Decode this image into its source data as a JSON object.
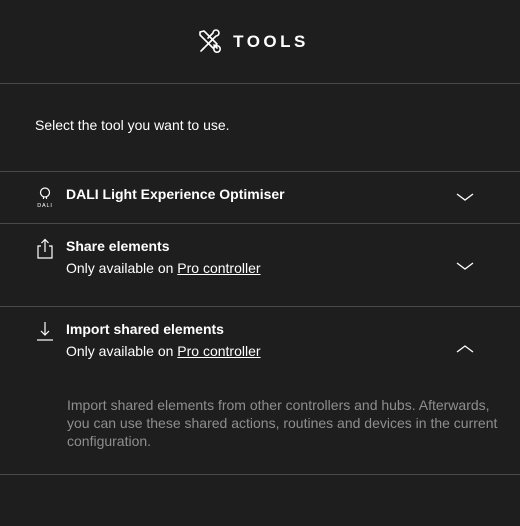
{
  "header": {
    "title": "TOOLS",
    "icon": "tools-icon"
  },
  "intro": "Select the tool you want to use.",
  "tools": [
    {
      "name": "DALI Light Experience Optimiser",
      "icon": "dali-bulb-icon",
      "icon_caption": "DALI",
      "expanded": false
    },
    {
      "name": "Share elements",
      "icon": "share-icon",
      "availability_prefix": "Only available on",
      "availability_link": "Pro controller",
      "expanded": false
    },
    {
      "name": "Import shared elements",
      "icon": "import-icon",
      "availability_prefix": "Only available on",
      "availability_link": "Pro controller",
      "expanded": true,
      "description": "Import shared elements from other controllers and hubs. Afterwards, you can use these shared actions, routines and devices in the current configuration."
    }
  ],
  "colors": {
    "background": "#1e1e1e",
    "divider": "#4a4a4a",
    "muted_text": "#8e8e8e"
  }
}
